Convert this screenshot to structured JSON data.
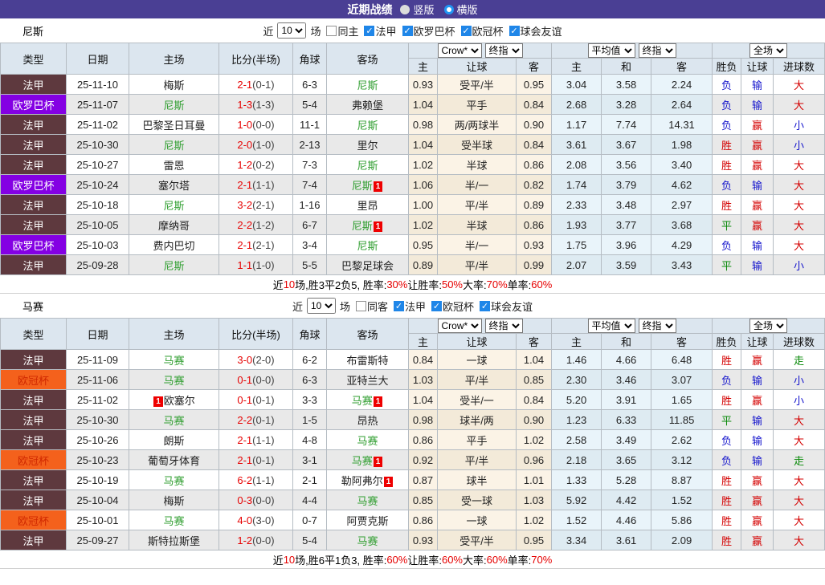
{
  "title_bar": {
    "title": "近期战绩",
    "options": [
      {
        "label": "竖版",
        "selected": false
      },
      {
        "label": "横版",
        "selected": true
      }
    ]
  },
  "table_header": {
    "left_cols": [
      "类型",
      "日期",
      "主场",
      "比分(半场)",
      "角球",
      "客场"
    ],
    "odds_dropdowns": [
      "Crow*",
      "终指"
    ],
    "odds_cols": [
      "主",
      "让球",
      "客"
    ],
    "avg_dropdowns": [
      "平均值",
      "终指"
    ],
    "avg_cols": [
      "主",
      "和",
      "客"
    ],
    "result_dropdown": "全场",
    "result_cols": [
      "胜负",
      "让球",
      "进球数"
    ]
  },
  "league_styles": {
    "法甲": {
      "bg": "#5e393e",
      "fg": "#ffffff"
    },
    "欧罗巴杯": {
      "bg": "#8400e3",
      "fg": "#ffffff"
    },
    "欧冠杯": {
      "bg": "#f4611c",
      "fg": "#d02800"
    }
  },
  "result_colors": {
    "胜": "#d40000",
    "平": "#0b8a0b",
    "负": "#1414cc",
    "赢": "#d40000",
    "输": "#1414cc",
    "大": "#d40000",
    "小": "#1414cc",
    "走": "#0b8a0b"
  },
  "sections": [
    {
      "team": "尼斯",
      "filter": {
        "near_label": "近",
        "count": "10",
        "games_label": "场",
        "same": {
          "label": "同主",
          "checked": false
        },
        "leagues": [
          {
            "label": "法甲",
            "checked": true
          },
          {
            "label": "欧罗巴杯",
            "checked": true
          },
          {
            "label": "欧冠杯",
            "checked": true
          },
          {
            "label": "球会友谊",
            "checked": true
          }
        ]
      },
      "rows": [
        {
          "league": "法甲",
          "date": "25-11-10",
          "home": {
            "name": "梅斯"
          },
          "score_full": "2-1",
          "score_half": "(0-1)",
          "corners": "6-3",
          "away": {
            "name": "尼斯",
            "focus": true
          },
          "odds": [
            "0.93",
            "受平/半",
            "0.95"
          ],
          "avg": [
            "3.04",
            "3.58",
            "2.24"
          ],
          "results": [
            "负",
            "输",
            "大"
          ]
        },
        {
          "league": "欧罗巴杯",
          "date": "25-11-07",
          "home": {
            "name": "尼斯",
            "focus": true
          },
          "score_full": "1-3",
          "score_half": "(1-3)",
          "corners": "5-4",
          "away": {
            "name": "弗赖堡"
          },
          "odds": [
            "1.04",
            "平手",
            "0.84"
          ],
          "avg": [
            "2.68",
            "3.28",
            "2.64"
          ],
          "results": [
            "负",
            "输",
            "大"
          ]
        },
        {
          "league": "法甲",
          "date": "25-11-02",
          "home": {
            "name": "巴黎圣日耳曼"
          },
          "score_full": "1-0",
          "score_half": "(0-0)",
          "corners": "11-1",
          "away": {
            "name": "尼斯",
            "focus": true
          },
          "odds": [
            "0.98",
            "两/两球半",
            "0.90"
          ],
          "avg": [
            "1.17",
            "7.74",
            "14.31"
          ],
          "results": [
            "负",
            "赢",
            "小"
          ]
        },
        {
          "league": "法甲",
          "date": "25-10-30",
          "home": {
            "name": "尼斯",
            "focus": true
          },
          "score_full": "2-0",
          "score_half": "(1-0)",
          "corners": "2-13",
          "away": {
            "name": "里尔"
          },
          "odds": [
            "1.04",
            "受半球",
            "0.84"
          ],
          "avg": [
            "3.61",
            "3.67",
            "1.98"
          ],
          "results": [
            "胜",
            "赢",
            "小"
          ]
        },
        {
          "league": "法甲",
          "date": "25-10-27",
          "home": {
            "name": "雷恩"
          },
          "score_full": "1-2",
          "score_half": "(0-2)",
          "corners": "7-3",
          "away": {
            "name": "尼斯",
            "focus": true
          },
          "odds": [
            "1.02",
            "半球",
            "0.86"
          ],
          "avg": [
            "2.08",
            "3.56",
            "3.40"
          ],
          "results": [
            "胜",
            "赢",
            "大"
          ]
        },
        {
          "league": "欧罗巴杯",
          "date": "25-10-24",
          "home": {
            "name": "塞尔塔"
          },
          "score_full": "2-1",
          "score_half": "(1-1)",
          "corners": "7-4",
          "away": {
            "name": "尼斯",
            "focus": true,
            "card": "1"
          },
          "odds": [
            "1.06",
            "半/一",
            "0.82"
          ],
          "avg": [
            "1.74",
            "3.79",
            "4.62"
          ],
          "results": [
            "负",
            "输",
            "大"
          ]
        },
        {
          "league": "法甲",
          "date": "25-10-18",
          "home": {
            "name": "尼斯",
            "focus": true
          },
          "score_full": "3-2",
          "score_half": "(2-1)",
          "corners": "1-16",
          "away": {
            "name": "里昂"
          },
          "odds": [
            "1.00",
            "平/半",
            "0.89"
          ],
          "avg": [
            "2.33",
            "3.48",
            "2.97"
          ],
          "results": [
            "胜",
            "赢",
            "大"
          ]
        },
        {
          "league": "法甲",
          "date": "25-10-05",
          "home": {
            "name": "摩纳哥"
          },
          "score_full": "2-2",
          "score_half": "(1-2)",
          "corners": "6-7",
          "away": {
            "name": "尼斯",
            "focus": true,
            "card": "1"
          },
          "odds": [
            "1.02",
            "半球",
            "0.86"
          ],
          "avg": [
            "1.93",
            "3.77",
            "3.68"
          ],
          "results": [
            "平",
            "赢",
            "大"
          ]
        },
        {
          "league": "欧罗巴杯",
          "date": "25-10-03",
          "home": {
            "name": "费内巴切"
          },
          "score_full": "2-1",
          "score_half": "(2-1)",
          "corners": "3-4",
          "away": {
            "name": "尼斯",
            "focus": true
          },
          "odds": [
            "0.95",
            "半/一",
            "0.93"
          ],
          "avg": [
            "1.75",
            "3.96",
            "4.29"
          ],
          "results": [
            "负",
            "输",
            "大"
          ]
        },
        {
          "league": "法甲",
          "date": "25-09-28",
          "home": {
            "name": "尼斯",
            "focus": true
          },
          "score_full": "1-1",
          "score_half": "(1-0)",
          "corners": "5-5",
          "away": {
            "name": "巴黎足球会"
          },
          "odds": [
            "0.89",
            "平/半",
            "0.99"
          ],
          "avg": [
            "2.07",
            "3.59",
            "3.43"
          ],
          "results": [
            "平",
            "输",
            "小"
          ]
        }
      ],
      "summary": [
        {
          "t": "近",
          "c": "k"
        },
        {
          "t": "10",
          "c": "r"
        },
        {
          "t": "场,胜3平2负5, 胜率:",
          "c": "k"
        },
        {
          "t": "30%",
          "c": "r"
        },
        {
          "t": " 让胜率:",
          "c": "k"
        },
        {
          "t": "50%",
          "c": "r"
        },
        {
          "t": " 大率:",
          "c": "k"
        },
        {
          "t": "70%",
          "c": "r"
        },
        {
          "t": " 单率:",
          "c": "k"
        },
        {
          "t": "60%",
          "c": "r"
        }
      ]
    },
    {
      "team": "马赛",
      "filter": {
        "near_label": "近",
        "count": "10",
        "games_label": "场",
        "same": {
          "label": "同客",
          "checked": false
        },
        "leagues": [
          {
            "label": "法甲",
            "checked": true
          },
          {
            "label": "欧冠杯",
            "checked": true
          },
          {
            "label": "球会友谊",
            "checked": true
          }
        ]
      },
      "rows": [
        {
          "league": "法甲",
          "date": "25-11-09",
          "home": {
            "name": "马赛",
            "focus": true
          },
          "score_full": "3-0",
          "score_half": "(2-0)",
          "corners": "6-2",
          "away": {
            "name": "布雷斯特"
          },
          "odds": [
            "0.84",
            "一球",
            "1.04"
          ],
          "avg": [
            "1.46",
            "4.66",
            "6.48"
          ],
          "results": [
            "胜",
            "赢",
            "走"
          ]
        },
        {
          "league": "欧冠杯",
          "date": "25-11-06",
          "home": {
            "name": "马赛",
            "focus": true
          },
          "score_full": "0-1",
          "score_half": "(0-0)",
          "corners": "6-3",
          "away": {
            "name": "亚特兰大"
          },
          "odds": [
            "1.03",
            "平/半",
            "0.85"
          ],
          "avg": [
            "2.30",
            "3.46",
            "3.07"
          ],
          "results": [
            "负",
            "输",
            "小"
          ]
        },
        {
          "league": "法甲",
          "date": "25-11-02",
          "home": {
            "name": "欧塞尔",
            "card": "1",
            "card_pos": "before"
          },
          "score_full": "0-1",
          "score_half": "(0-1)",
          "corners": "3-3",
          "away": {
            "name": "马赛",
            "focus": true,
            "card": "1"
          },
          "odds": [
            "1.04",
            "受半/一",
            "0.84"
          ],
          "avg": [
            "5.20",
            "3.91",
            "1.65"
          ],
          "results": [
            "胜",
            "赢",
            "小"
          ]
        },
        {
          "league": "法甲",
          "date": "25-10-30",
          "home": {
            "name": "马赛",
            "focus": true
          },
          "score_full": "2-2",
          "score_half": "(0-1)",
          "corners": "1-5",
          "away": {
            "name": "昂热"
          },
          "odds": [
            "0.98",
            "球半/两",
            "0.90"
          ],
          "avg": [
            "1.23",
            "6.33",
            "11.85"
          ],
          "results": [
            "平",
            "输",
            "大"
          ]
        },
        {
          "league": "法甲",
          "date": "25-10-26",
          "home": {
            "name": "朗斯"
          },
          "score_full": "2-1",
          "score_half": "(1-1)",
          "corners": "4-8",
          "away": {
            "name": "马赛",
            "focus": true
          },
          "odds": [
            "0.86",
            "平手",
            "1.02"
          ],
          "avg": [
            "2.58",
            "3.49",
            "2.62"
          ],
          "results": [
            "负",
            "输",
            "大"
          ]
        },
        {
          "league": "欧冠杯",
          "date": "25-10-23",
          "home": {
            "name": "葡萄牙体育"
          },
          "score_full": "2-1",
          "score_half": "(0-1)",
          "corners": "3-1",
          "away": {
            "name": "马赛",
            "focus": true,
            "card": "1"
          },
          "odds": [
            "0.92",
            "平/半",
            "0.96"
          ],
          "avg": [
            "2.18",
            "3.65",
            "3.12"
          ],
          "results": [
            "负",
            "输",
            "走"
          ]
        },
        {
          "league": "法甲",
          "date": "25-10-19",
          "home": {
            "name": "马赛",
            "focus": true
          },
          "score_full": "6-2",
          "score_half": "(1-1)",
          "corners": "2-1",
          "away": {
            "name": "勒阿弗尔",
            "card": "1"
          },
          "odds": [
            "0.87",
            "球半",
            "1.01"
          ],
          "avg": [
            "1.33",
            "5.28",
            "8.87"
          ],
          "results": [
            "胜",
            "赢",
            "大"
          ]
        },
        {
          "league": "法甲",
          "date": "25-10-04",
          "home": {
            "name": "梅斯"
          },
          "score_full": "0-3",
          "score_half": "(0-0)",
          "corners": "4-4",
          "away": {
            "name": "马赛",
            "focus": true
          },
          "odds": [
            "0.85",
            "受一球",
            "1.03"
          ],
          "avg": [
            "5.92",
            "4.42",
            "1.52"
          ],
          "results": [
            "胜",
            "赢",
            "大"
          ]
        },
        {
          "league": "欧冠杯",
          "date": "25-10-01",
          "home": {
            "name": "马赛",
            "focus": true
          },
          "score_full": "4-0",
          "score_half": "(3-0)",
          "corners": "0-7",
          "away": {
            "name": "阿贾克斯"
          },
          "odds": [
            "0.86",
            "一球",
            "1.02"
          ],
          "avg": [
            "1.52",
            "4.46",
            "5.86"
          ],
          "results": [
            "胜",
            "赢",
            "大"
          ]
        },
        {
          "league": "法甲",
          "date": "25-09-27",
          "home": {
            "name": "斯特拉斯堡"
          },
          "score_full": "1-2",
          "score_half": "(0-0)",
          "corners": "5-4",
          "away": {
            "name": "马赛",
            "focus": true
          },
          "odds": [
            "0.93",
            "受平/半",
            "0.95"
          ],
          "avg": [
            "3.34",
            "3.61",
            "2.09"
          ],
          "results": [
            "胜",
            "赢",
            "大"
          ]
        }
      ],
      "summary": [
        {
          "t": "近",
          "c": "k"
        },
        {
          "t": "10",
          "c": "r"
        },
        {
          "t": "场,胜6平1负3, 胜率:",
          "c": "k"
        },
        {
          "t": "60%",
          "c": "r"
        },
        {
          "t": " 让胜率:",
          "c": "k"
        },
        {
          "t": "60%",
          "c": "r"
        },
        {
          "t": " 大率:",
          "c": "k"
        },
        {
          "t": "60%",
          "c": "r"
        },
        {
          "t": " 单率:",
          "c": "k"
        },
        {
          "t": "70%",
          "c": "r"
        }
      ]
    }
  ]
}
